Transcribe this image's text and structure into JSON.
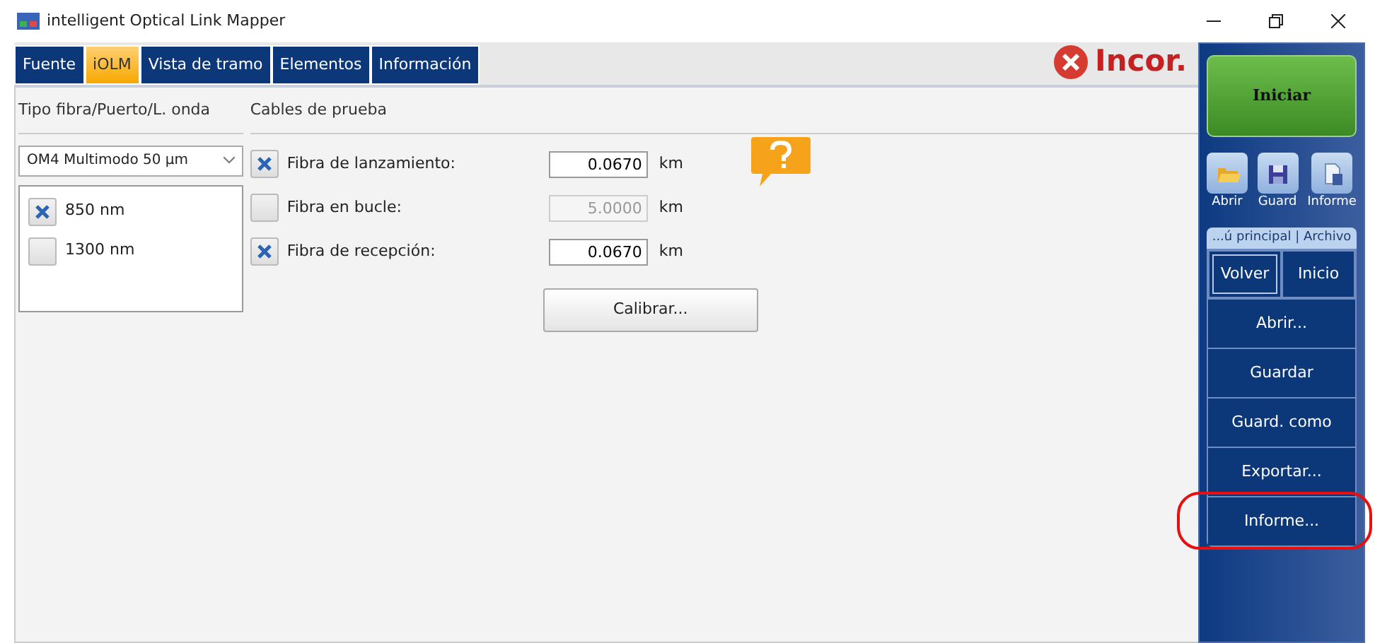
{
  "window": {
    "title": "intelligent Optical Link Mapper"
  },
  "tabs": [
    {
      "label": "Fuente",
      "selected": false
    },
    {
      "label": "iOLM",
      "selected": true
    },
    {
      "label": "Vista de tramo",
      "selected": false
    },
    {
      "label": "Elementos",
      "selected": false
    },
    {
      "label": "Información",
      "selected": false
    }
  ],
  "status": {
    "text": "Incor."
  },
  "fiber": {
    "heading": "Tipo fibra/Puerto/L. onda",
    "dropdown": "OM4 Multimodo 50 µm",
    "wavelengths": [
      {
        "label": "850 nm",
        "checked": true
      },
      {
        "label": "1300 nm",
        "checked": false
      }
    ]
  },
  "test_cables": {
    "heading": "Cables de prueba",
    "rows": [
      {
        "label": "Fibra de lanzamiento:",
        "checked": true,
        "value": "0.0670",
        "unit": "km",
        "disabled": false
      },
      {
        "label": "Fibra en bucle:",
        "checked": false,
        "value": "5.0000",
        "unit": "km",
        "disabled": true
      },
      {
        "label": "Fibra de recepción:",
        "checked": true,
        "value": "0.0670",
        "unit": "km",
        "disabled": false
      }
    ],
    "calibrate_button": "Calibrar..."
  },
  "side_panel": {
    "start_button": "Iniciar",
    "tools": [
      {
        "label": "Abrir",
        "kind": "folder"
      },
      {
        "label": "Guard",
        "kind": "disk"
      },
      {
        "label": "Informe",
        "kind": "report"
      }
    ],
    "breadcrumb": "...ú principal | Archivo",
    "nav": [
      {
        "label": "Volver",
        "selected": true
      },
      {
        "label": "Inicio",
        "selected": false
      }
    ],
    "menu": [
      {
        "label": "Abrir...",
        "highlighted": false
      },
      {
        "label": "Guardar",
        "highlighted": false
      },
      {
        "label": "Guard. como",
        "highlighted": false
      },
      {
        "label": "Exportar...",
        "highlighted": false
      },
      {
        "label": "Informe...",
        "highlighted": true
      }
    ]
  }
}
